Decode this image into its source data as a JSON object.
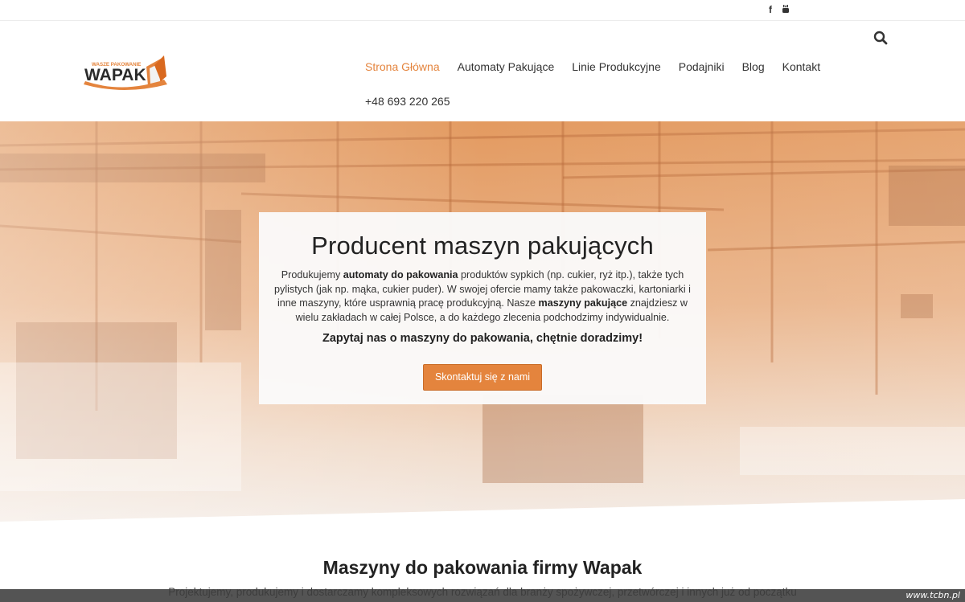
{
  "social": {
    "facebook_icon": "facebook-icon",
    "youtube_icon": "youtube-icon"
  },
  "logo": {
    "tagline": "WASZE PAKOWANIE",
    "name": "WAPAK"
  },
  "nav": {
    "items": [
      {
        "label": "Strona Główna",
        "active": true
      },
      {
        "label": "Automaty Pakujące",
        "active": false
      },
      {
        "label": "Linie Produkcyjne",
        "active": false
      },
      {
        "label": "Podajniki",
        "active": false
      },
      {
        "label": "Blog",
        "active": false
      },
      {
        "label": "Kontakt",
        "active": false
      }
    ],
    "phone": "+48 693 220 265"
  },
  "hero": {
    "title": "Producent maszyn pakujących",
    "text_1": "Produkujemy ",
    "bold_1": "automaty do pakowania",
    "text_2": " produktów sypkich (np. cukier, ryż itp.), także tych pylistych (jak np. mąka, cukier puder). W swojej ofercie mamy także pakowaczki, kartoniarki i inne maszyny, które usprawnią pracę produkcyjną. Nasze ",
    "bold_2": "maszyny pakujące",
    "text_3": " znajdziesz w wielu zakładach w całej Polsce, a do każdego zlecenia podchodzimy indywidualnie.",
    "cta_text": "Zapytaj nas o maszyny do pakowania, chętnie doradzimy!",
    "button_label": "Skontaktuj się z nami"
  },
  "section": {
    "title": "Maszyny do pakowania firmy Wapak",
    "text": "Projektujemy, produkujemy i dostarczamy kompleksowych rozwiązań dla branży spożywczej, przetwórczej i innych już od początku"
  },
  "watermark": "www.tcbn.pl",
  "colors": {
    "accent": "#e4843d",
    "hero_overlay": "#e7a16a"
  }
}
